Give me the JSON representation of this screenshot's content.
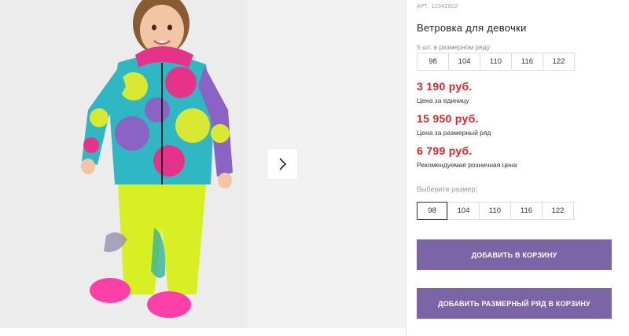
{
  "product": {
    "sku_label": "АРТ.",
    "sku_value": "12342002",
    "title": "Ветровка для девочки",
    "size_row_label": "5 шт. в размерном ряду",
    "size_row": [
      "98",
      "104",
      "110",
      "116",
      "122"
    ],
    "prices": [
      {
        "amount": "3 190 руб.",
        "note": "Цена за единицу"
      },
      {
        "amount": "15 950 руб.",
        "note": "Цена за размерный ряд"
      },
      {
        "amount": "6 799 руб.",
        "note": "Рекомендуемая розничная цена"
      }
    ],
    "choose_size_label": "Выберите размер:",
    "size_options": [
      "98",
      "104",
      "110",
      "116",
      "122"
    ],
    "selected_size": "98",
    "add_to_cart": "ДОБАВИТЬ В КОРЗИНУ",
    "add_row_to_cart": "ДОБАВИТЬ РАЗМЕРНЫЙ РЯД В КОРЗИНУ"
  },
  "gallery": {
    "next_icon": "chevron-right-icon"
  },
  "colors": {
    "price": "#d4282c",
    "button": "#7c64a6",
    "border": "#dedede"
  }
}
